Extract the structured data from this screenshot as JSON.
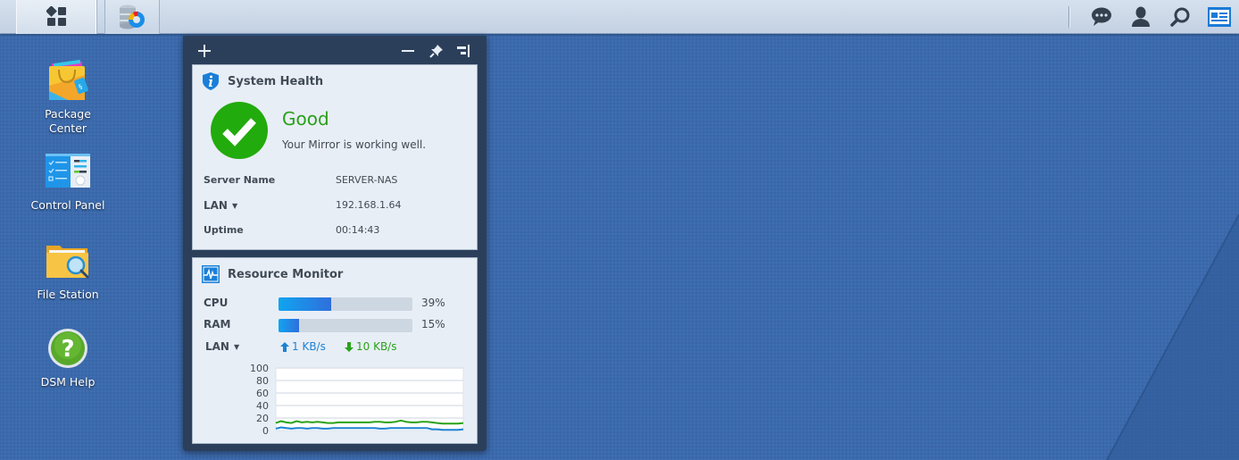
{
  "taskbar": {
    "main_menu_icon": "main-menu-grid-icon",
    "open_app_icon": "resource-monitor-app-icon",
    "right_icons": [
      "notifications-chat-icon",
      "user-icon",
      "search-icon",
      "widgets-toggle-icon"
    ]
  },
  "desktop": {
    "icons": [
      {
        "label": "Package\nCenter",
        "icon": "package-center-icon"
      },
      {
        "label": "Control Panel",
        "icon": "control-panel-icon"
      },
      {
        "label": "File Station",
        "icon": "file-station-icon"
      },
      {
        "label": "DSM Help",
        "icon": "dsm-help-icon"
      }
    ]
  },
  "widget_panel": {
    "add_icon": "+",
    "minimize_icon": "minus-icon",
    "pin_icon": "pin-icon",
    "collapse_icon": "collapse-right-icon",
    "system_health": {
      "title": "System Health",
      "status": "Good",
      "status_color": "#28a01a",
      "description": "Your Mirror is working well.",
      "rows": [
        {
          "label": "Server Name",
          "value": "SERVER-NAS",
          "dropdown": false
        },
        {
          "label": "LAN",
          "value": "192.168.1.64",
          "dropdown": true
        },
        {
          "label": "Uptime",
          "value": "00:14:43",
          "dropdown": false
        }
      ]
    },
    "resource_monitor": {
      "title": "Resource Monitor",
      "cpu": {
        "label": "CPU",
        "percent": 39,
        "text": "39%"
      },
      "ram": {
        "label": "RAM",
        "percent": 15,
        "text": "15%"
      },
      "lan": {
        "label": "LAN",
        "upload": "1 KB/s",
        "download": "10 KB/s"
      }
    }
  },
  "chart_data": {
    "type": "line",
    "title": "",
    "xlabel": "",
    "ylabel": "",
    "ylim": [
      0,
      100
    ],
    "yticks": [
      100,
      80,
      60,
      40,
      20,
      0
    ],
    "grid": true,
    "series": [
      {
        "name": "download",
        "color": "#2aa31a",
        "values": [
          12,
          15,
          13,
          12,
          15,
          13,
          14,
          13,
          14,
          13,
          12,
          12,
          13,
          13,
          13,
          13,
          13,
          13,
          13,
          14,
          14,
          13,
          13,
          14,
          16,
          14,
          13,
          13,
          14,
          14,
          13,
          12,
          11,
          11,
          11,
          11,
          12
        ]
      },
      {
        "name": "upload",
        "color": "#1d82d3",
        "values": [
          3,
          5,
          4,
          3,
          4,
          4,
          3,
          4,
          4,
          3,
          3,
          4,
          4,
          4,
          4,
          4,
          4,
          4,
          4,
          4,
          3,
          3,
          4,
          4,
          4,
          4,
          4,
          4,
          4,
          4,
          2,
          2,
          1,
          1,
          1,
          1,
          2
        ]
      }
    ]
  }
}
